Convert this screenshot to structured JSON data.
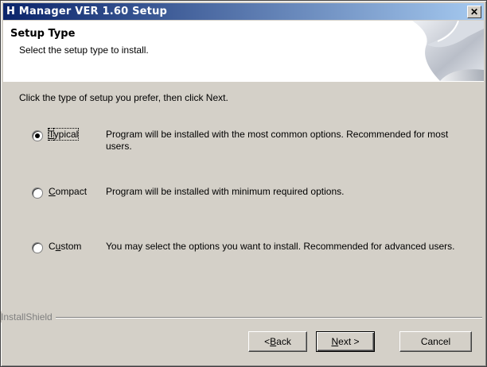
{
  "window": {
    "title": "H Manager VER 1.60 Setup",
    "close_glyph": "✕"
  },
  "header": {
    "title": "Setup Type",
    "subtitle": "Select the setup type to install."
  },
  "intro": "Click the type of setup you prefer, then click Next.",
  "options": [
    {
      "label_pre": "",
      "label_accel": "T",
      "label_post": "ypical",
      "description": "Program will be installed with the most common options.  Recommended for most users.",
      "selected": true
    },
    {
      "label_pre": "",
      "label_accel": "C",
      "label_post": "ompact",
      "description": "Program will be installed with minimum required options.",
      "selected": false
    },
    {
      "label_pre": "C",
      "label_accel": "u",
      "label_post": "stom",
      "description": "You may select the options you want to install. Recommended for advanced users.",
      "selected": false
    }
  ],
  "branding": "InstallShield",
  "buttons": {
    "back": {
      "pre": "< ",
      "accel": "B",
      "post": "ack"
    },
    "next": {
      "pre": "",
      "accel": "N",
      "post": "ext >"
    },
    "cancel": {
      "label": "Cancel"
    }
  }
}
